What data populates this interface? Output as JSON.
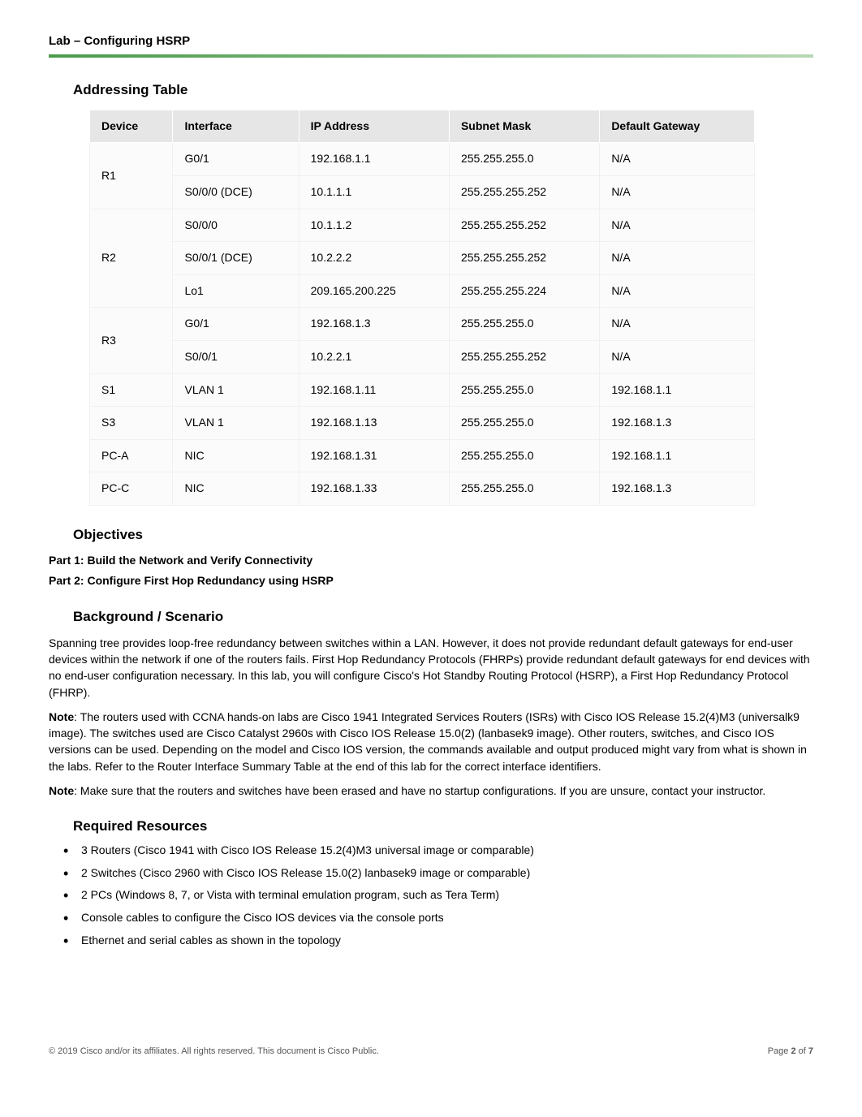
{
  "header": {
    "title": "Lab – Configuring HSRP"
  },
  "addressing": {
    "heading": "Addressing Table",
    "columns": [
      "Device",
      "Interface",
      "IP Address",
      "Subnet Mask",
      "Default Gateway"
    ],
    "rows": [
      {
        "device": "R1",
        "rowspan": 2,
        "iface": "G0/1",
        "ip": "192.168.1.1",
        "mask": "255.255.255.0",
        "gw": "N/A"
      },
      {
        "device": "",
        "rowspan": 0,
        "iface": "S0/0/0 (DCE)",
        "ip": "10.1.1.1",
        "mask": "255.255.255.252",
        "gw": "N/A"
      },
      {
        "device": "R2",
        "rowspan": 3,
        "iface": "S0/0/0",
        "ip": "10.1.1.2",
        "mask": "255.255.255.252",
        "gw": "N/A"
      },
      {
        "device": "",
        "rowspan": 0,
        "iface": "S0/0/1 (DCE)",
        "ip": "10.2.2.2",
        "mask": "255.255.255.252",
        "gw": "N/A"
      },
      {
        "device": "",
        "rowspan": 0,
        "iface": "Lo1",
        "ip": "209.165.200.225",
        "mask": "255.255.255.224",
        "gw": "N/A"
      },
      {
        "device": "R3",
        "rowspan": 2,
        "iface": "G0/1",
        "ip": "192.168.1.3",
        "mask": "255.255.255.0",
        "gw": "N/A"
      },
      {
        "device": "",
        "rowspan": 0,
        "iface": "S0/0/1",
        "ip": "10.2.2.1",
        "mask": "255.255.255.252",
        "gw": "N/A"
      },
      {
        "device": "S1",
        "rowspan": 1,
        "iface": "VLAN 1",
        "ip": "192.168.1.11",
        "mask": "255.255.255.0",
        "gw": "192.168.1.1"
      },
      {
        "device": "S3",
        "rowspan": 1,
        "iface": "VLAN 1",
        "ip": "192.168.1.13",
        "mask": "255.255.255.0",
        "gw": "192.168.1.3"
      },
      {
        "device": "PC-A",
        "rowspan": 1,
        "iface": "NIC",
        "ip": "192.168.1.31",
        "mask": "255.255.255.0",
        "gw": "192.168.1.1"
      },
      {
        "device": "PC-C",
        "rowspan": 1,
        "iface": "NIC",
        "ip": "192.168.1.33",
        "mask": "255.255.255.0",
        "gw": "192.168.1.3"
      }
    ]
  },
  "objectives": {
    "heading": "Objectives",
    "part1": "Part 1: Build the Network and Verify Connectivity",
    "part2": "Part 2: Configure First Hop Redundancy using HSRP"
  },
  "background": {
    "heading": "Background / Scenario",
    "p1": "Spanning tree provides loop-free redundancy between switches within a LAN. However, it does not provide redundant default gateways for end-user devices within the network if one of the routers fails. First Hop Redundancy Protocols (FHRPs) provide redundant default gateways for end devices with no end-user configuration necessary. In this lab, you will configure Cisco's Hot Standby Routing Protocol (HSRP), a First Hop Redundancy Protocol (FHRP).",
    "p2_prefix": "Note",
    "p2": ": The routers used with CCNA hands-on labs are Cisco 1941 Integrated Services Routers (ISRs) with Cisco IOS Release 15.2(4)M3 (universalk9 image). The switches used are Cisco Catalyst 2960s with Cisco IOS Release 15.0(2) (lanbasek9 image). Other routers, switches, and Cisco IOS versions can be used. Depending on the model and Cisco IOS version, the commands available and output produced might vary from what is shown in the labs. Refer to the Router Interface Summary Table at the end of this lab for the correct interface identifiers.",
    "p3_prefix": "Note",
    "p3": ": Make sure that the routers and switches have been erased and have no startup configurations. If you are unsure, contact your instructor."
  },
  "required": {
    "heading": "Required Resources",
    "items": [
      "3 Routers (Cisco 1941 with Cisco IOS Release 15.2(4)M3 universal image or comparable)",
      "2 Switches (Cisco 2960 with Cisco IOS Release 15.0(2) lanbasek9 image or comparable)",
      "2 PCs (Windows 8, 7, or Vista with terminal emulation program, such as Tera Term)",
      "Console cables to configure the Cisco IOS devices via the console ports",
      "Ethernet and serial cables as shown in the topology"
    ]
  },
  "footer": {
    "left": "© 2019 Cisco and/or its affiliates. All rights reserved. This document is Cisco Public.",
    "right_prefix": "Page ",
    "right_page": "2",
    "right_mid": " of ",
    "right_total": "7"
  }
}
